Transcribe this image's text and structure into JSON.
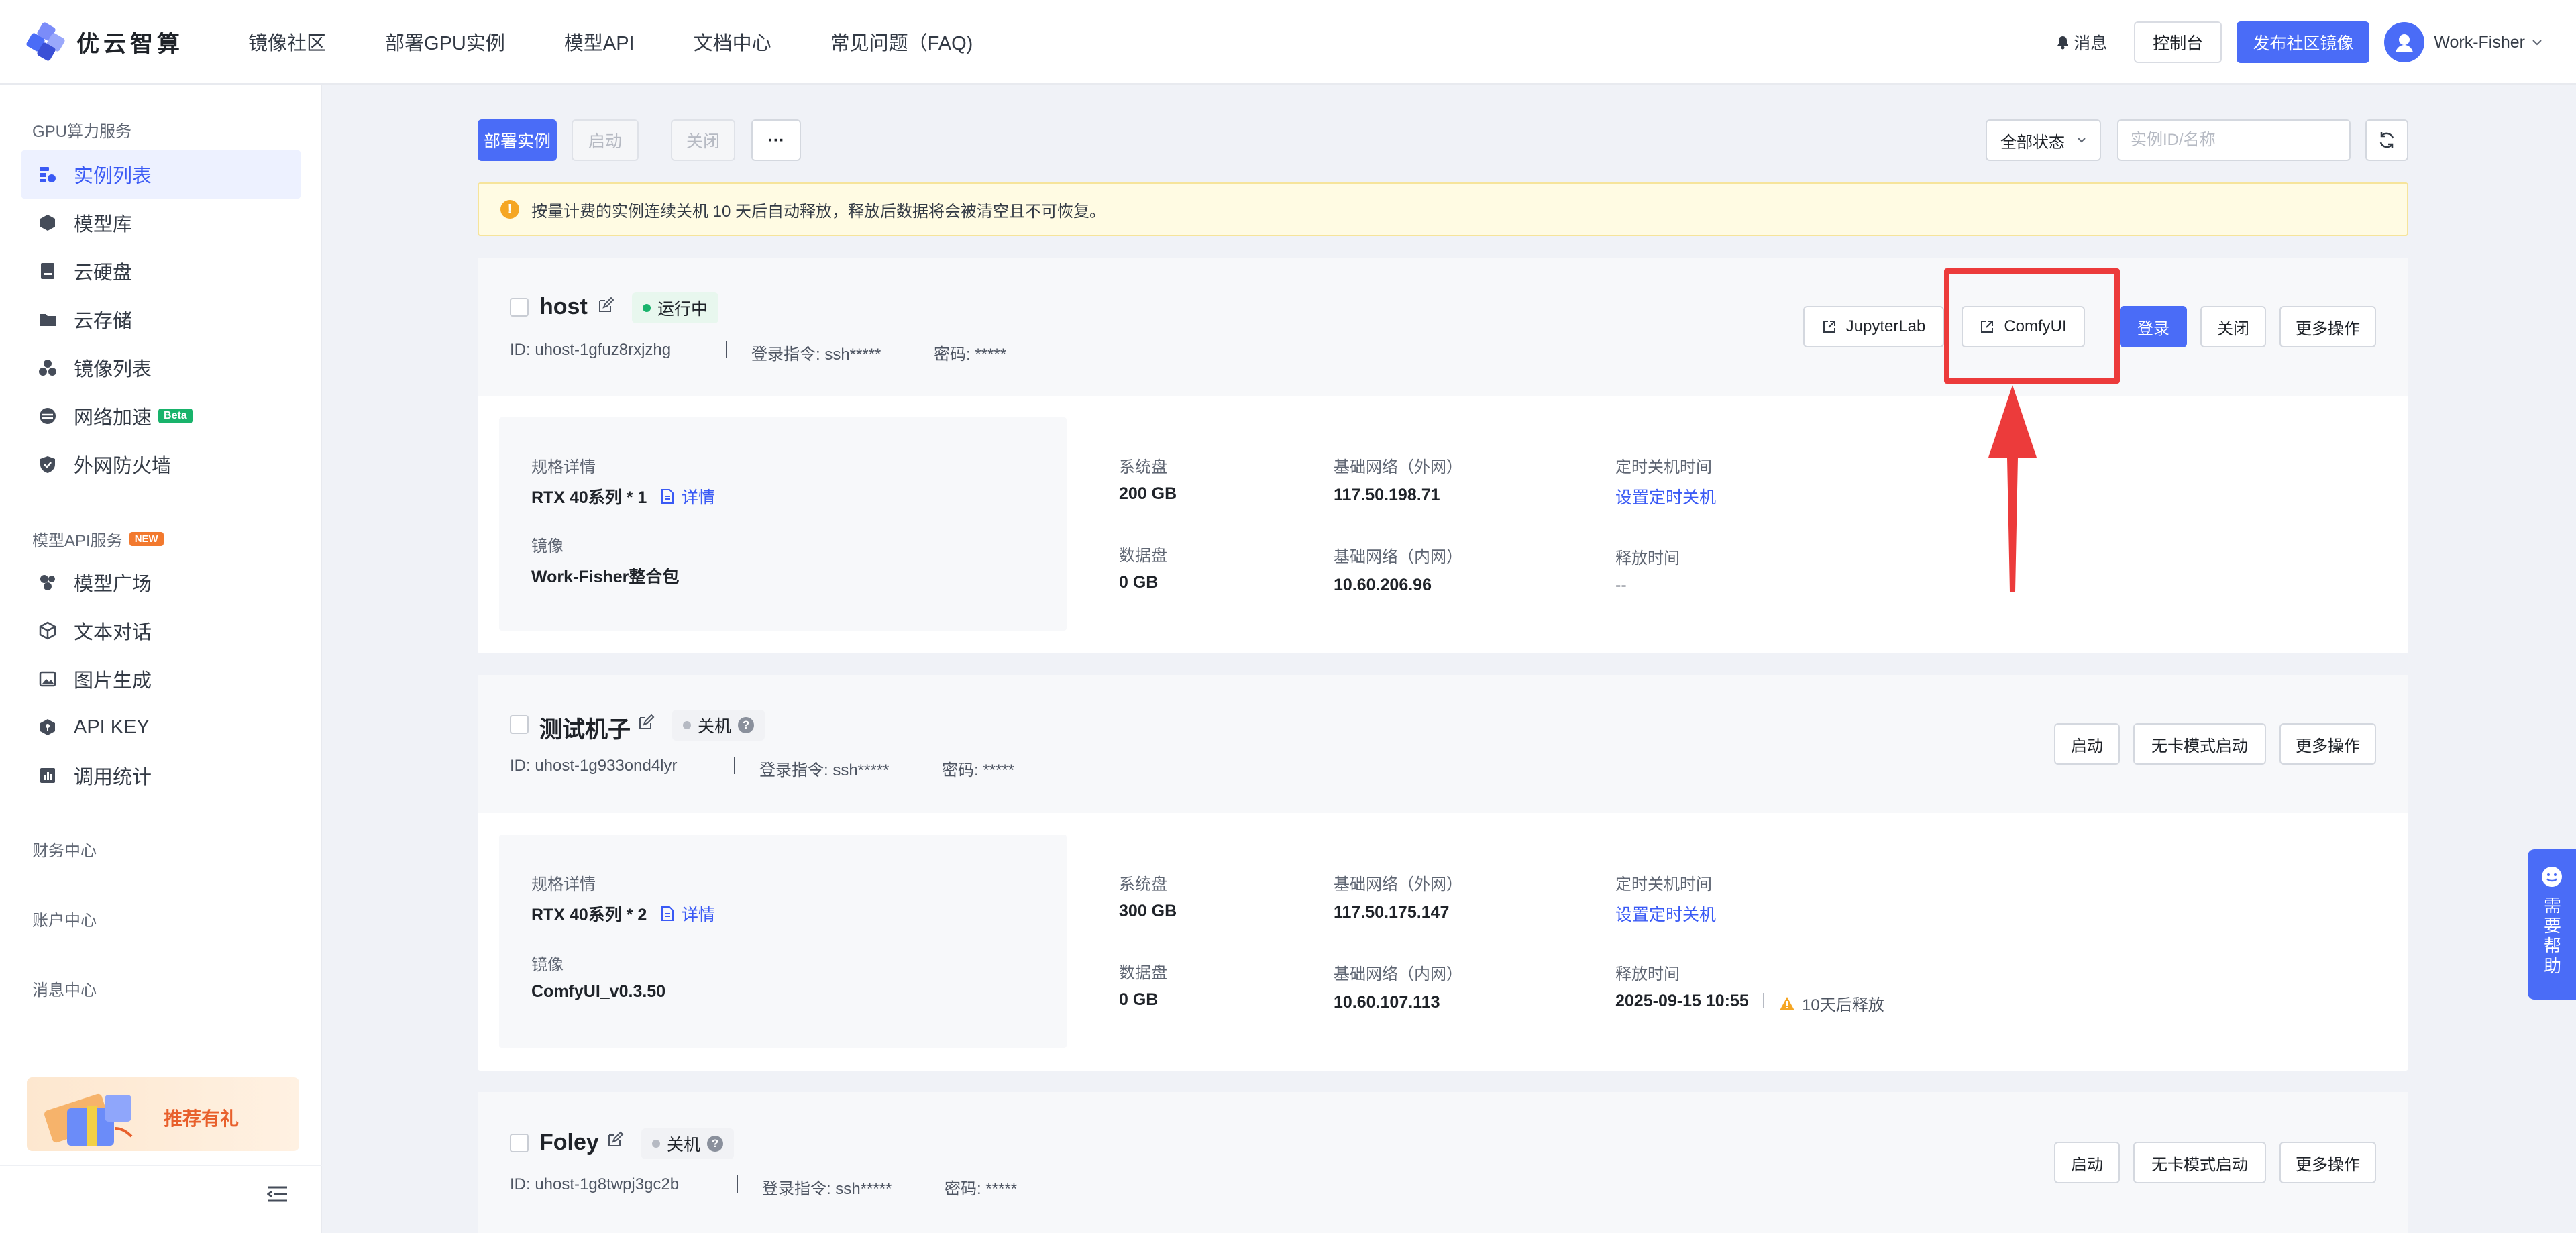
{
  "brand": {
    "name": "优云智算"
  },
  "nav": [
    {
      "label": "镜像社区"
    },
    {
      "label": "部署GPU实例"
    },
    {
      "label": "模型API"
    },
    {
      "label": "文档中心"
    },
    {
      "label": "常见问题（FAQ)"
    }
  ],
  "top_right": {
    "messages": "消息",
    "console": "控制台",
    "publish": "发布社区镜像",
    "user": "Work-Fisher"
  },
  "sidebar": {
    "gpu_section": "GPU算力服务",
    "gpu_items": [
      {
        "label": "实例列表",
        "icon": "instance-list-icon",
        "active": true
      },
      {
        "label": "模型库",
        "icon": "model-library-icon"
      },
      {
        "label": "云硬盘",
        "icon": "cloud-disk-icon"
      },
      {
        "label": "云存储",
        "icon": "cloud-storage-icon"
      },
      {
        "label": "镜像列表",
        "icon": "image-list-icon"
      },
      {
        "label": "网络加速",
        "icon": "network-accel-icon",
        "badge": "Beta"
      },
      {
        "label": "外网防火墙",
        "icon": "firewall-icon"
      }
    ],
    "api_section": "模型API服务",
    "api_badge": "NEW",
    "api_items": [
      {
        "label": "模型广场",
        "icon": "model-plaza-icon"
      },
      {
        "label": "文本对话",
        "icon": "text-chat-icon"
      },
      {
        "label": "图片生成",
        "icon": "image-gen-icon"
      },
      {
        "label": "API KEY",
        "icon": "api-key-icon"
      },
      {
        "label": "调用统计",
        "icon": "usage-stats-icon"
      }
    ],
    "finance": "财务中心",
    "account": "账户中心",
    "message_center": "消息中心",
    "promo": "推荐有礼"
  },
  "toolbar": {
    "deploy": "部署实例",
    "start": "启动",
    "close": "关闭",
    "more": "···",
    "status_filter": "全部状态",
    "search_placeholder": "实例ID/名称"
  },
  "notice": "按量计费的实例连续关机 10 天后自动释放，释放后数据将会被清空且不可恢复。",
  "instances": [
    {
      "name": "host",
      "status": "运行中",
      "id": "ID: uhost-1gfuz8rxjzhg",
      "login": "登录指令: ssh*****",
      "password": "密码: *****",
      "actions": {
        "jupyter": "JupyterLab",
        "comfy": "ComfyUI",
        "login": "登录",
        "close": "关闭",
        "more": "更多操作"
      },
      "spec_label": "规格详情",
      "spec": "RTX 40系列 * 1",
      "detail": "详情",
      "image_label": "镜像",
      "image": "Work-Fisher整合包",
      "sys_disk_label": "系统盘",
      "sys_disk": "200 GB",
      "data_disk_label": "数据盘",
      "data_disk": "0 GB",
      "ext_net_label": "基础网络（外网）",
      "ext_net": "117.50.198.71",
      "int_net_label": "基础网络（内网）",
      "int_net": "10.60.206.96",
      "shutdown_label": "定时关机时间",
      "shutdown_link": "设置定时关机",
      "release_label": "释放时间",
      "release": "--"
    },
    {
      "name": "测试机子",
      "status": "关机",
      "id": "ID: uhost-1g933ond4lyr",
      "login": "登录指令: ssh*****",
      "password": "密码: *****",
      "actions": {
        "start": "启动",
        "cardless": "无卡模式启动",
        "more": "更多操作"
      },
      "spec_label": "规格详情",
      "spec": "RTX 40系列 * 2",
      "detail": "详情",
      "image_label": "镜像",
      "image": "ComfyUI_v0.3.50",
      "sys_disk_label": "系统盘",
      "sys_disk": "300 GB",
      "data_disk_label": "数据盘",
      "data_disk": "0 GB",
      "ext_net_label": "基础网络（外网）",
      "ext_net": "117.50.175.147",
      "int_net_label": "基础网络（内网）",
      "int_net": "10.60.107.113",
      "shutdown_label": "定时关机时间",
      "shutdown_link": "设置定时关机",
      "release_label": "释放时间",
      "release": "2025-09-15 10:55",
      "release_warn": "10天后释放"
    },
    {
      "name": "Foley",
      "status": "关机",
      "id": "ID: uhost-1g8twpj3gc2b",
      "login": "登录指令: ssh*****",
      "password": "密码: *****",
      "actions": {
        "start": "启动",
        "cardless": "无卡模式启动",
        "more": "更多操作"
      }
    }
  ],
  "help": "需要帮助",
  "colors": {
    "accent": "#4a6cf7",
    "highlight": "#ec3b3b",
    "running": "#18b36b",
    "notice_bg": "#fffbe3"
  }
}
